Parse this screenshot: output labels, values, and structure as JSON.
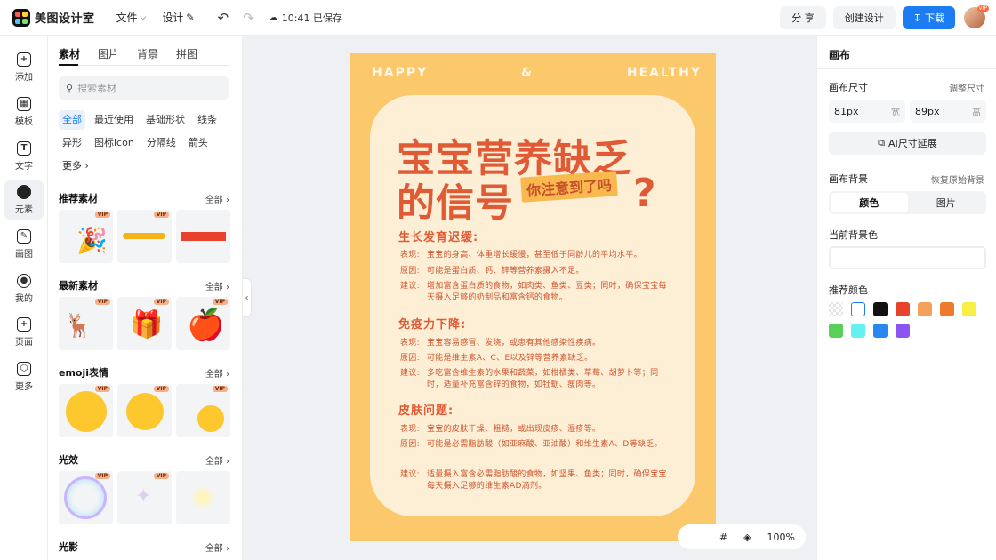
{
  "app": {
    "name": "美图设计室"
  },
  "topbar": {
    "file_label": "文件",
    "design_label": "设计",
    "save_status": "10:41 已保存",
    "share_label": "分 享",
    "create_label": "创建设计",
    "download_label": "下载",
    "avatar_badge": "VIP"
  },
  "leftnav": [
    {
      "label": "添加",
      "icon": "plus-icon"
    },
    {
      "label": "模板",
      "icon": "template-icon"
    },
    {
      "label": "文字",
      "icon": "text-icon"
    },
    {
      "label": "元素",
      "icon": "shapes-icon"
    },
    {
      "label": "画图",
      "icon": "draw-icon"
    },
    {
      "label": "我的",
      "icon": "user-icon"
    },
    {
      "label": "页面",
      "icon": "page-icon"
    },
    {
      "label": "更多",
      "icon": "box-icon"
    }
  ],
  "panel": {
    "tabs": [
      "素材",
      "图片",
      "背景",
      "拼图"
    ],
    "search_placeholder": "搜索素材",
    "chips": [
      "全部",
      "最近使用",
      "基础形状",
      "线条",
      "异形",
      "图标icon",
      "分隔线",
      "箭头",
      "更多"
    ],
    "sections": [
      {
        "title": "推荐素材",
        "all": "全部"
      },
      {
        "title": "最新素材",
        "all": "全部"
      },
      {
        "title": "emoji表情",
        "all": "全部"
      },
      {
        "title": "光效",
        "all": "全部"
      },
      {
        "title": "光影",
        "all": "全部"
      }
    ],
    "vip": "VIP"
  },
  "poster": {
    "header": [
      "HAPPY",
      "&",
      "HEALTHY"
    ],
    "title_line1": "宝宝营养缺乏",
    "title_line2": "的信号",
    "tag": "你注意到了吗",
    "qmark": "?",
    "sections": [
      {
        "heading": "生长发育迟缓:",
        "lines": [
          {
            "k": "表现:",
            "v": "宝宝的身高、体重增长缓慢，甚至低于同龄儿的平均水平。"
          },
          {
            "k": "原因:",
            "v": "可能是蛋白质、钙、锌等营养素摄入不足。"
          },
          {
            "k": "建议:",
            "v": "增加富含蛋白质的食物，如肉类、鱼类、豆类；同时，确保宝宝每天摄入足够的奶制品和富含钙的食物。"
          }
        ]
      },
      {
        "heading": "免疫力下降:",
        "lines": [
          {
            "k": "表现:",
            "v": "宝宝容易感冒、发烧，或患有其他感染性疾病。"
          },
          {
            "k": "原因:",
            "v": "可能是维生素A、C、E以及锌等营养素缺乏。"
          },
          {
            "k": "建议:",
            "v": "多吃富含维生素的水果和蔬菜，如柑橘类、草莓、胡萝卜等；同时，适量补充富含锌的食物，如牡蛎、瘦肉等。"
          }
        ]
      },
      {
        "heading": "皮肤问题:",
        "lines": [
          {
            "k": "表现:",
            "v": "宝宝的皮肤干燥、粗糙，或出现皮疹、湿疹等。"
          },
          {
            "k": "原因:",
            "v": "可能是必需脂肪酸（如亚麻酸、亚油酸）和维生素A、D等缺乏。"
          },
          {
            "k": "建议:",
            "v": "适量摄入富含必需脂肪酸的食物，如坚果、鱼类；同时，确保宝宝每天摄入足够的维生素AD滴剂。"
          }
        ]
      }
    ]
  },
  "zoom": {
    "value": "100%"
  },
  "right": {
    "title": "画布",
    "size_label": "画布尺寸",
    "resize_link": "调整尺寸",
    "width_value": "81px",
    "width_unit": "宽",
    "height_value": "89px",
    "height_unit": "高",
    "ai_button": "AI尺寸延展",
    "bg_label": "画布背景",
    "restore_link": "恢复原始背景",
    "seg_color": "颜色",
    "seg_image": "图片",
    "current_bg_label": "当前背景色",
    "recommend_label": "推荐颜色",
    "swatches": [
      "transparent",
      "#ffffff",
      "#111111",
      "#e8412c",
      "#f5a05a",
      "#ee7a2e",
      "#f6f045",
      "#58d05a",
      "#66f0f0",
      "#2a86f0",
      "#8a55f0"
    ]
  }
}
